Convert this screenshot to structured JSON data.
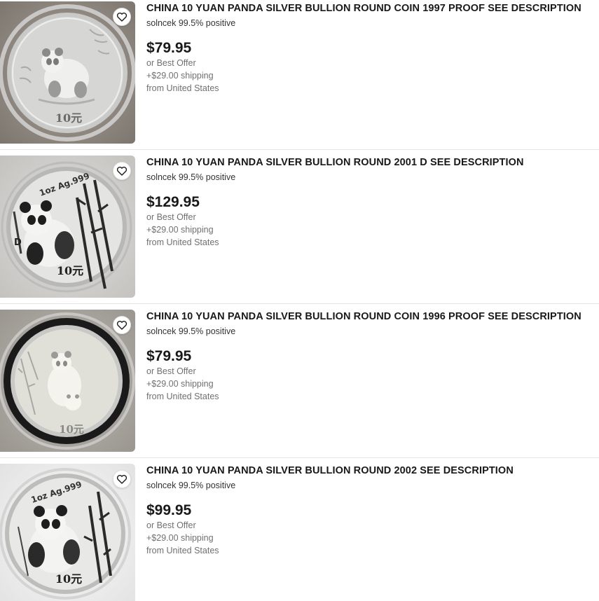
{
  "colors": {
    "text_primary": "#191919",
    "text_secondary": "#707070",
    "divider": "#e5e5e5"
  },
  "icons": {
    "watch": "heart-icon"
  },
  "items": [
    {
      "title": "CHINA 10 YUAN PANDA SILVER BULLION ROUND COIN 1997 PROOF SEE DESCRIPTION",
      "seller": "solncek 99.5% positive",
      "price": "$79.95",
      "offer": "or Best Offer",
      "shipping": "+$29.00 shipping",
      "location": "from United States",
      "coin_text": {
        "denomination": "10元",
        "inscription": ""
      }
    },
    {
      "title": "CHINA 10 YUAN PANDA SILVER BULLION ROUND 2001 D SEE DESCRIPTION",
      "seller": "solncek 99.5% positive",
      "price": "$129.95",
      "offer": "or Best Offer",
      "shipping": "+$29.00 shipping",
      "location": "from United States",
      "coin_text": {
        "denomination": "10元",
        "inscription": "1oz Ag.999",
        "mint_mark": "D"
      }
    },
    {
      "title": "CHINA 10 YUAN PANDA SILVER BULLION ROUND COIN 1996 PROOF SEE DESCRIPTION",
      "seller": "solncek 99.5% positive",
      "price": "$79.95",
      "offer": "or Best Offer",
      "shipping": "+$29.00 shipping",
      "location": "from United States",
      "coin_text": {
        "denomination": "10元",
        "inscription": ""
      }
    },
    {
      "title": "CHINA 10 YUAN PANDA SILVER BULLION ROUND 2002 SEE DESCRIPTION",
      "seller": "solncek 99.5% positive",
      "price": "$99.95",
      "offer": "or Best Offer",
      "shipping": "+$29.00 shipping",
      "location": "from United States",
      "coin_text": {
        "denomination": "10元",
        "inscription": "1oz Ag.999"
      }
    }
  ]
}
